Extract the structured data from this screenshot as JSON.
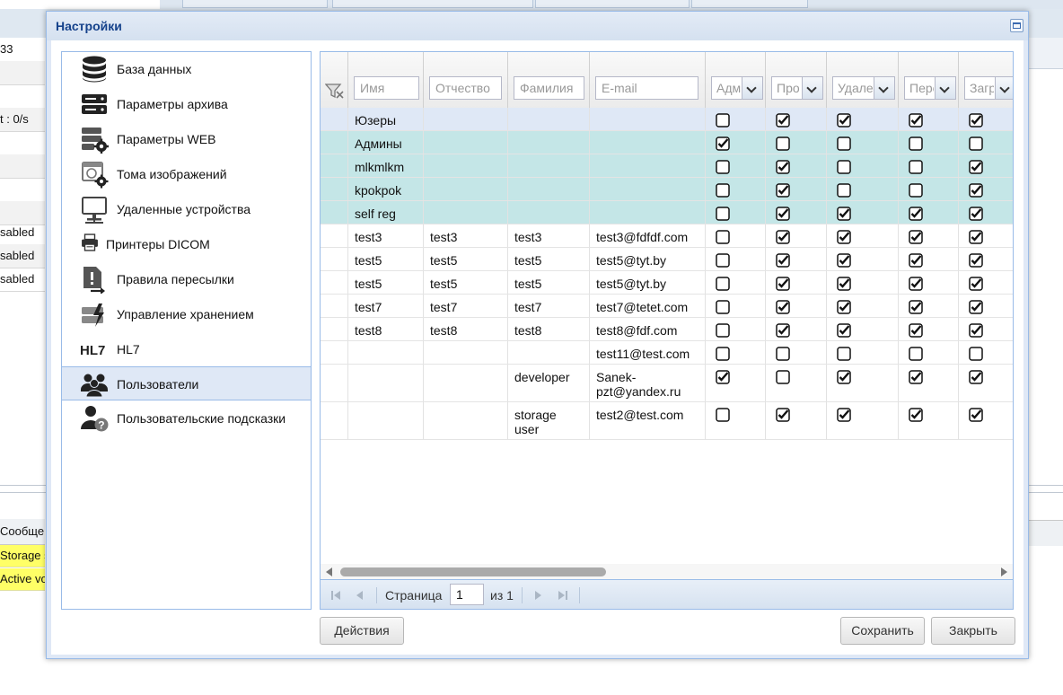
{
  "background": {
    "left_rows": [
      "33",
      "",
      "",
      "t : 0/s",
      "",
      "",
      "",
      "",
      "sabled",
      "sabled",
      "sabled"
    ],
    "message_header": "Сообщен",
    "messages": [
      "Storage s",
      "Active vo"
    ]
  },
  "dialog": {
    "title": "Настройки"
  },
  "nav": {
    "items": [
      {
        "label": "База данных",
        "icon": "database-icon"
      },
      {
        "label": "Параметры архива",
        "icon": "server-icon"
      },
      {
        "label": "Параметры WEB",
        "icon": "server-gear-icon"
      },
      {
        "label": "Тома изображений",
        "icon": "image-volume-icon"
      },
      {
        "label": "Удаленные устройства",
        "icon": "monitor-icon"
      },
      {
        "label": "Принтеры DICOM",
        "icon": "printer-icon"
      },
      {
        "label": "Правила пересылки",
        "icon": "forward-rule-icon"
      },
      {
        "label": "Управление хранением",
        "icon": "storage-management-icon"
      },
      {
        "label": "HL7",
        "icon": "hl7-icon"
      },
      {
        "label": "Пользователи",
        "icon": "users-icon"
      },
      {
        "label": "Пользовательские подсказки",
        "icon": "user-help-icon"
      }
    ],
    "selected": "Пользователи"
  },
  "grid": {
    "filters": {
      "first_name": "Имя",
      "middle_name": "Отчество",
      "last_name": "Фамилия",
      "email": "E-mail",
      "admin": "Адми",
      "view": "Про",
      "delete": "Удале",
      "forward": "Пере",
      "upload": "Загр"
    },
    "rows": [
      {
        "type": "group-first",
        "first_name": "Юзеры",
        "middle_name": "",
        "last_name": "",
        "email": "",
        "flags": [
          false,
          true,
          true,
          true,
          true
        ]
      },
      {
        "type": "group",
        "first_name": "Админы",
        "middle_name": "",
        "last_name": "",
        "email": "",
        "flags": [
          true,
          false,
          false,
          false,
          false
        ]
      },
      {
        "type": "group",
        "first_name": "mlkmlkm",
        "middle_name": "",
        "last_name": "",
        "email": "",
        "flags": [
          false,
          true,
          false,
          false,
          true
        ]
      },
      {
        "type": "group",
        "first_name": "kpokpok",
        "middle_name": "",
        "last_name": "",
        "email": "",
        "flags": [
          false,
          true,
          false,
          false,
          true
        ]
      },
      {
        "type": "group",
        "first_name": "self reg",
        "middle_name": "",
        "last_name": "",
        "email": "",
        "flags": [
          false,
          true,
          true,
          true,
          true
        ]
      },
      {
        "type": "user",
        "first_name": "test3",
        "middle_name": "test3",
        "last_name": "test3",
        "email": "test3@fdfdf.com",
        "flags": [
          false,
          true,
          true,
          true,
          true
        ]
      },
      {
        "type": "user",
        "first_name": "test5",
        "middle_name": "test5",
        "last_name": "test5",
        "email": "test5@tyt.by",
        "flags": [
          false,
          true,
          true,
          true,
          true
        ]
      },
      {
        "type": "user",
        "first_name": "test5",
        "middle_name": "test5",
        "last_name": "test5",
        "email": "test5@tyt.by",
        "flags": [
          false,
          true,
          true,
          true,
          true
        ]
      },
      {
        "type": "user",
        "first_name": "test7",
        "middle_name": "test7",
        "last_name": "test7",
        "email": "test7@tetet.com",
        "flags": [
          false,
          true,
          true,
          true,
          true
        ]
      },
      {
        "type": "user",
        "first_name": "test8",
        "middle_name": "test8",
        "last_name": "test8",
        "email": "test8@fdf.com",
        "flags": [
          false,
          true,
          true,
          true,
          true
        ]
      },
      {
        "type": "user",
        "first_name": "",
        "middle_name": "",
        "last_name": "",
        "email": "test11@test.com",
        "flags": [
          false,
          false,
          false,
          false,
          false
        ]
      },
      {
        "type": "user",
        "first_name": "",
        "middle_name": "",
        "last_name": "developer",
        "email": "Sanek-pzt@yandex.ru",
        "flags": [
          true,
          false,
          true,
          true,
          true
        ]
      },
      {
        "type": "user",
        "first_name": "",
        "middle_name": "",
        "last_name": "storage user",
        "email": "test2@test.com",
        "flags": [
          false,
          true,
          true,
          true,
          true
        ]
      }
    ]
  },
  "pager": {
    "page_label": "Страница",
    "page_value": "1",
    "of_label": "из 1"
  },
  "buttons": {
    "actions": "Действия",
    "save": "Сохранить",
    "close": "Закрыть"
  }
}
